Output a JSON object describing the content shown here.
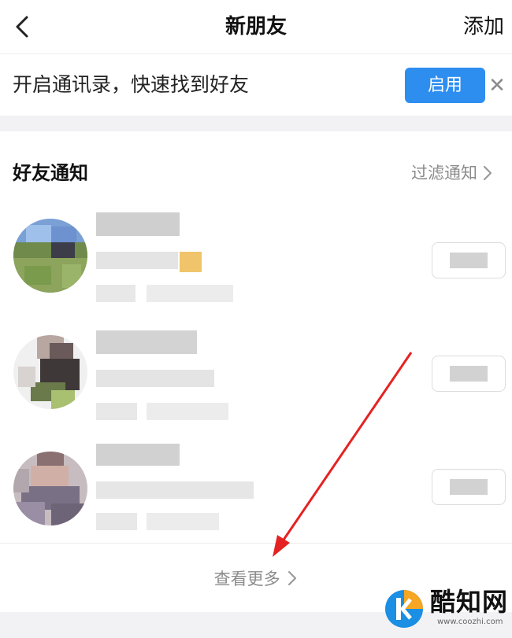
{
  "header": {
    "back_icon": "chevron-left-icon",
    "title": "新朋友",
    "add_label": "添加"
  },
  "contacts_banner": {
    "text": "开启通讯录，快速找到好友",
    "enable_label": "启用",
    "close_icon": "close-icon",
    "enable_color": "#2d8ef0"
  },
  "notifications": {
    "title": "好友通知",
    "filter_label": "过滤通知",
    "requests": [
      {
        "avatar": "pixelated-avatar-landscape",
        "accept_button": "pixelated"
      },
      {
        "avatar": "pixelated-avatar-dark",
        "accept_button": "pixelated"
      },
      {
        "avatar": "pixelated-avatar-portrait",
        "accept_button": "pixelated"
      }
    ],
    "see_more_label": "查看更多"
  },
  "watermark": {
    "brand": "酷知网",
    "url": "www.coozhi.com"
  },
  "annotation": {
    "color": "#e52222",
    "icon": "red-arrow-pointing-to-see-more"
  }
}
